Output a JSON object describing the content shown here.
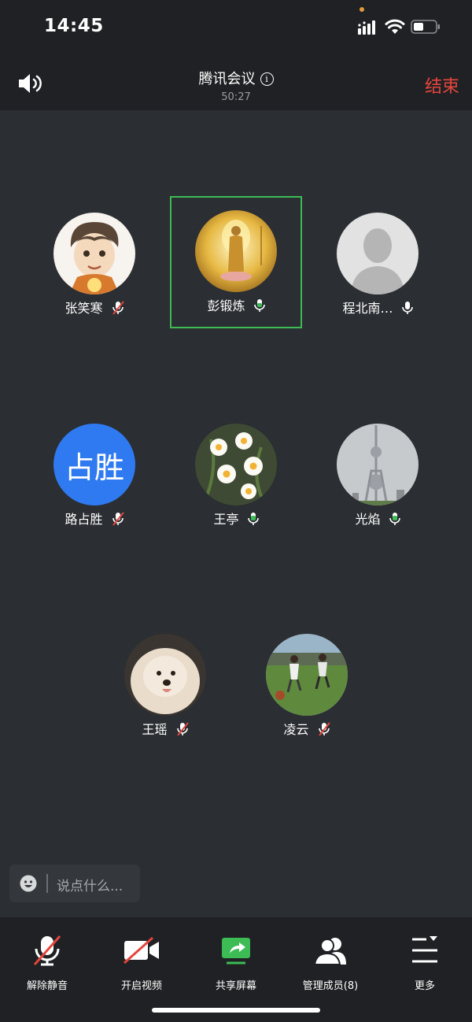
{
  "status": {
    "time": "14:45"
  },
  "header": {
    "title": "腾讯会议",
    "timer": "50:27",
    "end_label": "结束"
  },
  "participants": [
    {
      "name": "张笑寒",
      "mic": "muted",
      "avatar": "cartoon-portrait"
    },
    {
      "name": "彭锻炼",
      "mic": "on",
      "avatar": "golden-buddha",
      "active_speaker": true
    },
    {
      "name": "程北南…",
      "mic": "on",
      "avatar": "default-silhouette"
    },
    {
      "name": "路占胜",
      "mic": "muted",
      "avatar": "initials",
      "initials": "占胜",
      "avatar_color": "#2f7af0"
    },
    {
      "name": "王亭",
      "mic": "on",
      "avatar": "daffodil-flowers"
    },
    {
      "name": "光焰",
      "mic": "on",
      "avatar": "tower-photo"
    },
    {
      "name": "王瑶",
      "mic": "muted",
      "avatar": "fluffy-dog"
    },
    {
      "name": "凌云",
      "mic": "muted",
      "avatar": "kids-soccer"
    }
  ],
  "chat": {
    "placeholder": "说点什么..."
  },
  "toolbar": {
    "unmute_label": "解除静音",
    "video_label": "开启视频",
    "share_label": "共享屏幕",
    "members_label": "管理成员(8)",
    "more_label": "更多"
  },
  "colors": {
    "accent_green": "#3dbb55",
    "danger_red": "#e5453d",
    "initials_blue": "#2f7af0"
  }
}
